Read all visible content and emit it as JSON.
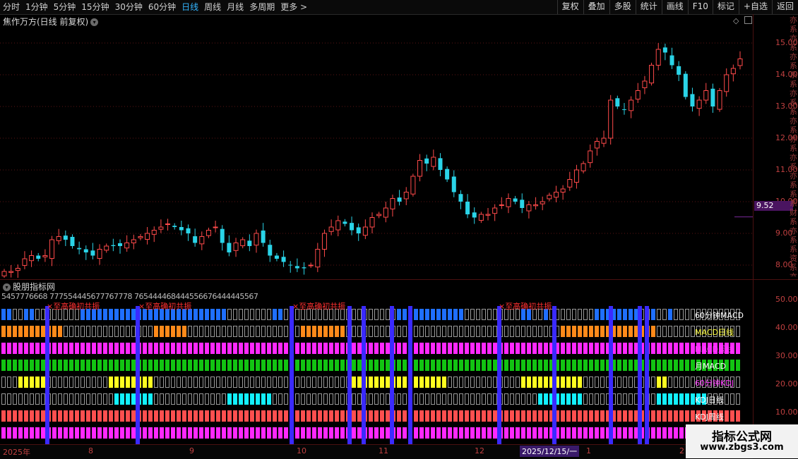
{
  "toolbar": {
    "periods": [
      "分时",
      "1分钟",
      "5分钟",
      "15分钟",
      "30分钟",
      "60分钟",
      "日线",
      "周线",
      "月线",
      "多周期",
      "更多 >"
    ],
    "active_period": "日线",
    "right_buttons": [
      "复权",
      "叠加",
      "多股",
      "统计",
      "画线",
      "F10",
      "标记",
      "+自选",
      "返回"
    ]
  },
  "main_chart": {
    "title": "焦作万方(日线 前复权)",
    "current_price": "9.52",
    "y_ticks": [
      "15.00",
      "14.00",
      "13.00",
      "12.00",
      "11.00",
      "10.00",
      "9.00",
      "8.00"
    ],
    "right_column_text": "亦系亦系亦系系系亦系系亦系亦系亦系亦系系系财系亦系系资系亦系外系亦系资系"
  },
  "indicator_panel": {
    "title": "股朋指标网",
    "y_ticks": [
      "50.00",
      "40.00",
      "30.00",
      "20.00",
      "10.00"
    ],
    "top_digits": "5457776668 777554445677767778 765444468444556676444445567",
    "row_labels": [
      {
        "text": "60分钟MACD",
        "color": "#ffffff"
      },
      {
        "text": "MACD日线",
        "color": "#ffff40"
      },
      {
        "text": "MACD周线",
        "color": "#ff40ff"
      },
      {
        "text": "月MACD",
        "color": "#ffffff"
      },
      {
        "text": "60分钟KDJ",
        "color": "#ff40ff"
      },
      {
        "text": "KDJ日线",
        "color": "#ffffff"
      },
      {
        "text": "KDJ周线",
        "color": "#ffffff"
      }
    ],
    "red_labels": [
      "×至高确初共振",
      "×至高确初共振",
      "×至高确初共振",
      "×至高确初共振"
    ]
  },
  "x_axis": {
    "labels": [
      "2025年",
      "8",
      "9",
      "10",
      "11",
      "12",
      "1",
      "2"
    ],
    "cursor_label": "2025/12/15/一"
  },
  "watermark": {
    "line1": "指标公式网",
    "line2": "www.zbgs3.com"
  },
  "chart_data": {
    "type": "candlestick",
    "title": "焦作万方(日线 前复权)",
    "ylim": [
      7.6,
      15.6
    ],
    "y_ticks": [
      8,
      9,
      10,
      11,
      12,
      13,
      14,
      15
    ],
    "close_series": [
      7.8,
      7.8,
      7.9,
      8.2,
      8.3,
      8.2,
      8.3,
      8.8,
      8.9,
      8.8,
      8.6,
      8.5,
      8.4,
      8.3,
      8.5,
      8.6,
      8.6,
      8.6,
      8.7,
      8.8,
      8.9,
      9.0,
      9.1,
      9.2,
      9.3,
      9.2,
      9.1,
      9.0,
      8.7,
      8.9,
      9.1,
      9.2,
      8.7,
      8.4,
      8.7,
      8.8,
      8.6,
      9.0,
      8.7,
      8.3,
      8.2,
      8.1,
      8.0,
      7.9,
      7.9,
      8.0,
      8.5,
      9.0,
      9.2,
      9.4,
      9.3,
      9.1,
      9.0,
      9.2,
      9.5,
      9.6,
      9.8,
      10.1,
      10.0,
      10.3,
      10.8,
      11.3,
      11.2,
      11.4,
      11.0,
      10.7,
      10.3,
      10.0,
      9.6,
      9.5,
      9.6,
      9.6,
      9.8,
      9.9,
      10.1,
      10.0,
      9.8,
      9.9,
      9.9,
      10.0,
      10.2,
      10.3,
      10.4,
      10.7,
      11.0,
      11.2,
      11.6,
      11.9,
      12.0,
      13.2,
      13.0,
      12.9,
      13.2,
      13.5,
      13.8,
      14.3,
      14.8,
      14.7,
      14.3,
      14.0,
      13.3,
      13.0,
      13.2,
      13.5,
      13.0,
      13.5,
      14.0,
      14.2,
      14.5
    ],
    "last_price": 9.52
  }
}
